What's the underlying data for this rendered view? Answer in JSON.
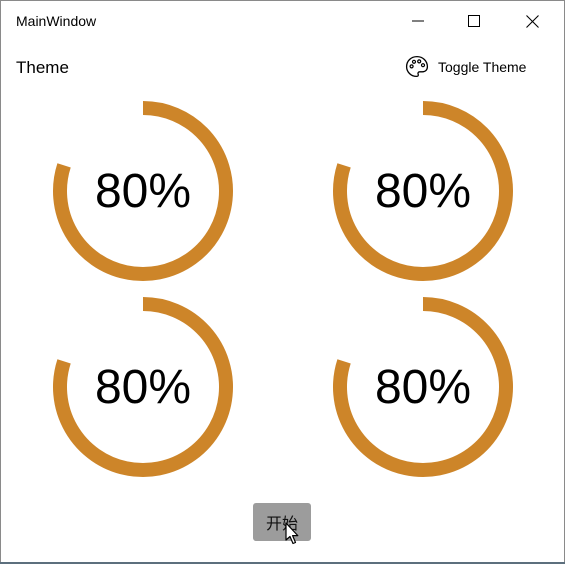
{
  "window": {
    "title": "MainWindow",
    "controls": [
      "minimize-icon",
      "maximize-icon",
      "close-icon"
    ]
  },
  "header": {
    "title": "Theme",
    "toggle_label": "Toggle Theme",
    "toggle_icon": "palette-icon"
  },
  "progress_rings": [
    {
      "value": 0.8,
      "label": "80%"
    },
    {
      "value": 0.8,
      "label": "80%"
    },
    {
      "value": 0.8,
      "label": "80%"
    },
    {
      "value": 0.8,
      "label": "80%"
    }
  ],
  "colors": {
    "ring": "#CD8529",
    "start_button": "#9C9C9C"
  },
  "actions": {
    "start_label": "开始"
  }
}
